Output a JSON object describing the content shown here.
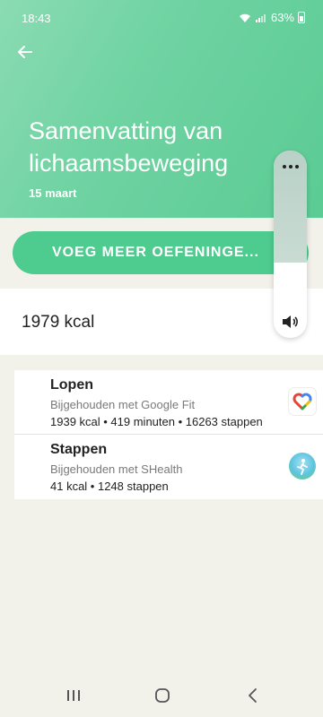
{
  "status": {
    "time": "18:43",
    "battery": "63%"
  },
  "header": {
    "title": "Samenvatting van lichaamsbeweging",
    "date": "15 maart",
    "back_icon": "arrow-left-icon"
  },
  "add_button": {
    "label": "VOEG MEER OEFENINGE..."
  },
  "summary": {
    "kcal": "1979 kcal"
  },
  "activities": [
    {
      "title": "Lopen",
      "source": "Bijgehouden met Google Fit",
      "stats": "1939 kcal • 419 minuten • 16263 stappen",
      "icon": "google-fit-icon"
    },
    {
      "title": "Stappen",
      "source": "Bijgehouden met SHealth",
      "stats": "41 kcal • 1248 stappen",
      "icon": "samsung-health-icon"
    }
  ],
  "volume_panel": {
    "level": 0.6
  },
  "colors": {
    "accent": "#4ecb8e",
    "header": "#6fd3a2"
  }
}
